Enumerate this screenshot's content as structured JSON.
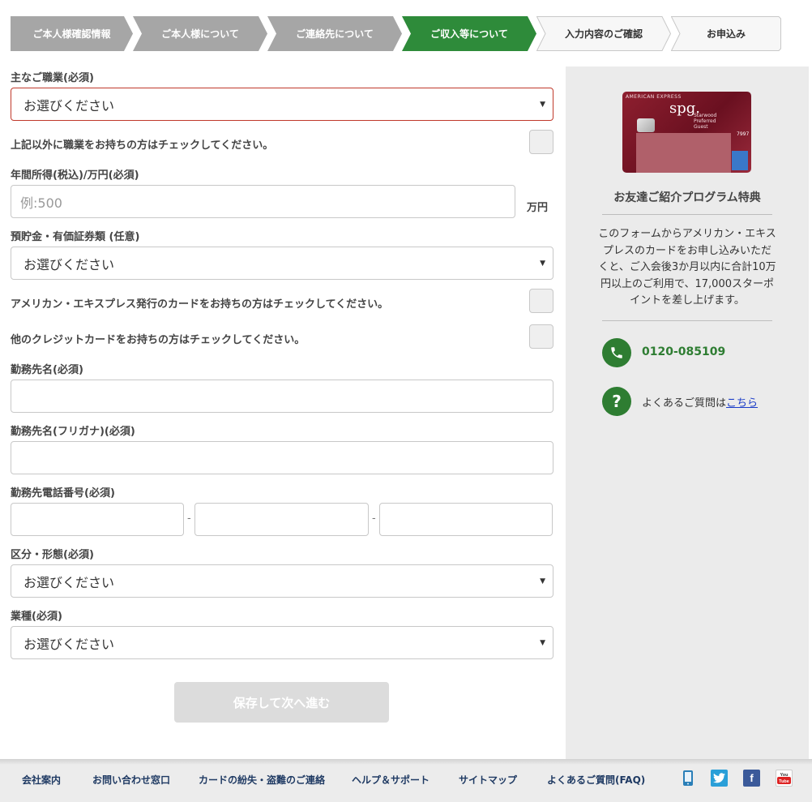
{
  "stepper": {
    "steps": [
      {
        "label": "ご本人様確認情報",
        "state": "done"
      },
      {
        "label": "ご本人様について",
        "state": "done"
      },
      {
        "label": "ご連絡先について",
        "state": "done"
      },
      {
        "label": "ご収入等について",
        "state": "active"
      },
      {
        "label": "入力内容のご確認",
        "state": "todo"
      },
      {
        "label": "お申込み",
        "state": "todo"
      }
    ]
  },
  "form": {
    "occupation": {
      "label": "主なご職業(必須)",
      "value": "お選びください"
    },
    "other_job": {
      "label": "上記以外に職業をお持ちの方はチェックしてください。"
    },
    "income": {
      "label": "年間所得(税込)/万円(必須)",
      "placeholder": "例:500",
      "unit": "万円"
    },
    "savings": {
      "label": "預貯金・有価証券類 (任意)",
      "value": "お選びください"
    },
    "amex_card": {
      "label": "アメリカン・エキスプレス発行のカードをお持ちの方はチェックしてください。"
    },
    "other_card": {
      "label": "他のクレジットカードをお持ちの方はチェックしてください。"
    },
    "employer": {
      "label": "勤務先名(必須)",
      "value": ""
    },
    "employer_kana": {
      "label": "勤務先名(フリガナ)(必須)",
      "value": ""
    },
    "employer_phone": {
      "label": "勤務先電話番号(必須)",
      "sep": "-"
    },
    "category": {
      "label": "区分・形態(必須)",
      "value": "お選びください"
    },
    "industry": {
      "label": "業種(必須)",
      "value": "お選びください"
    },
    "submit_label": "保存して次へ進む"
  },
  "sidebar": {
    "card": {
      "brand": "AMERICAN EXPRESS",
      "logo": "spg.",
      "sub1": "Starwood",
      "sub2": "Preferred",
      "sub3": "Guest",
      "number": "7997"
    },
    "title": "お友達ご紹介プログラム特典",
    "text": "このフォームからアメリカン・エキスプレスのカードをお申し込みいただくと、ご入会後3か月以内に合計10万円以上のご利用で、17,000スターポイントを差し上げます。",
    "phone": "0120-085109",
    "faq_prefix": "よくあるご質問は",
    "faq_link": "こちら"
  },
  "footer": {
    "links": [
      "会社案内",
      "お問い合わせ窓口",
      "カードの紛失・盗難のご連絡",
      "ヘルプ＆サポート",
      "サイトマップ",
      "よくあるご質問(FAQ)"
    ]
  },
  "colors": {
    "accent_green": "#2e7d32",
    "done_gray": "#a6a6a6",
    "error_red": "#c0392b"
  }
}
